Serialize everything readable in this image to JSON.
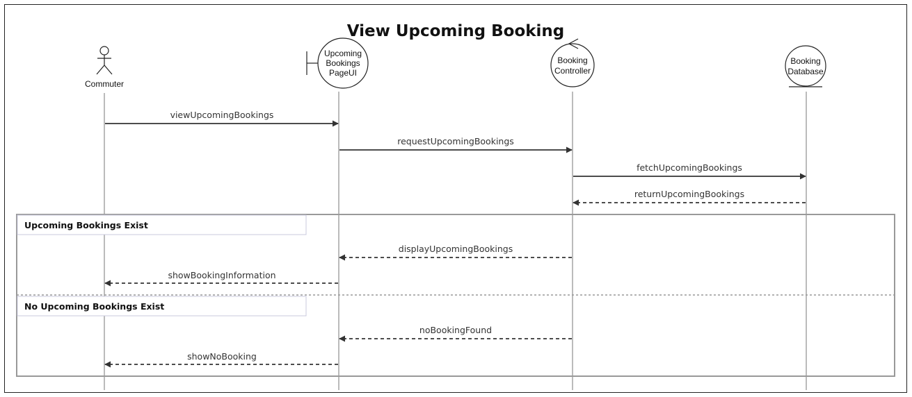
{
  "title": "View Upcoming Booking",
  "participants": [
    {
      "id": "commuter",
      "kind": "actor",
      "label_lines": [
        "Commuter"
      ]
    },
    {
      "id": "page_ui",
      "kind": "boundary",
      "label_lines": [
        "Upcoming",
        "Bookings",
        "PageUI"
      ]
    },
    {
      "id": "controller",
      "kind": "control",
      "label_lines": [
        "Booking",
        "Controller"
      ]
    },
    {
      "id": "database",
      "kind": "entity",
      "label_lines": [
        "Booking",
        "Database"
      ]
    }
  ],
  "messages": [
    {
      "label": "viewUpcomingBookings",
      "from": "commuter",
      "to": "page_ui",
      "style": "solid"
    },
    {
      "label": "requestUpcomingBookings",
      "from": "page_ui",
      "to": "controller",
      "style": "solid"
    },
    {
      "label": "fetchUpcomingBookings",
      "from": "controller",
      "to": "database",
      "style": "solid"
    },
    {
      "label": "returnUpcomingBookings",
      "from": "database",
      "to": "controller",
      "style": "dashed"
    }
  ],
  "alt_fragment": {
    "sections": [
      {
        "guard": "Upcoming Bookings Exist",
        "messages": [
          {
            "label": "displayUpcomingBookings",
            "from": "controller",
            "to": "page_ui",
            "style": "dashed"
          },
          {
            "label": "showBookingInformation",
            "from": "page_ui",
            "to": "commuter",
            "style": "dashed"
          }
        ]
      },
      {
        "guard": "No Upcoming Bookings Exist",
        "messages": [
          {
            "label": "noBookingFound",
            "from": "controller",
            "to": "page_ui",
            "style": "dashed"
          },
          {
            "label": "showNoBooking",
            "from": "page_ui",
            "to": "commuter",
            "style": "dashed"
          }
        ]
      }
    ]
  }
}
